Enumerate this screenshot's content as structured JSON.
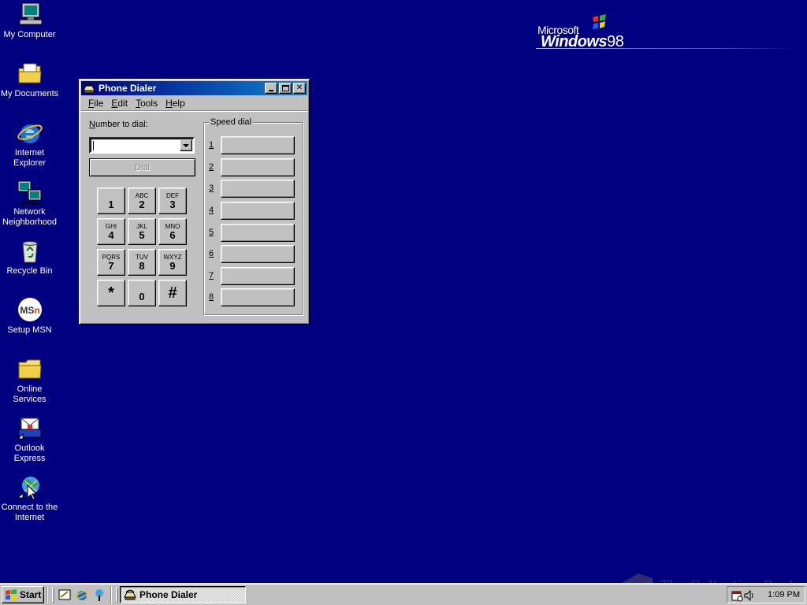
{
  "desktop": {
    "icons": [
      {
        "label": "My Computer"
      },
      {
        "label": "My Documents"
      },
      {
        "label": "Internet Explorer"
      },
      {
        "label": "Network Neighborhood"
      },
      {
        "label": "Recycle Bin"
      },
      {
        "label": "Setup MSN"
      },
      {
        "label": "Online Services"
      },
      {
        "label": "Outlook Express"
      },
      {
        "label": "Connect to the Internet"
      }
    ],
    "logo": {
      "brand": "Microsoft",
      "product": "Windows",
      "version": "98"
    }
  },
  "window": {
    "title": "Phone Dialer",
    "menu": [
      {
        "accel": "F",
        "rest": "ile"
      },
      {
        "accel": "E",
        "rest": "dit"
      },
      {
        "accel": "T",
        "rest": "ools"
      },
      {
        "accel": "H",
        "rest": "elp"
      }
    ],
    "number_label_accel": "N",
    "number_label_rest": "umber to dial:",
    "number_value": "",
    "dial_label": "Dial",
    "keypad": [
      {
        "letters": "",
        "digit": "1"
      },
      {
        "letters": "ABC",
        "digit": "2"
      },
      {
        "letters": "DEF",
        "digit": "3"
      },
      {
        "letters": "GHI",
        "digit": "4"
      },
      {
        "letters": "JKL",
        "digit": "5"
      },
      {
        "letters": "MNO",
        "digit": "6"
      },
      {
        "letters": "PQRS",
        "digit": "7"
      },
      {
        "letters": "TUV",
        "digit": "8"
      },
      {
        "letters": "WXYZ",
        "digit": "9"
      },
      {
        "letters": "",
        "digit": "*"
      },
      {
        "letters": "",
        "digit": "0"
      },
      {
        "letters": "",
        "digit": "#"
      }
    ],
    "speed_dial_label": "Speed dial",
    "speed_dial": [
      "1",
      "2",
      "3",
      "4",
      "5",
      "6",
      "7",
      "8"
    ]
  },
  "taskbar": {
    "start_label": "Start",
    "tasks": [
      {
        "label": "Phone Dialer"
      }
    ],
    "clock": "1:09 PM"
  },
  "watermark": "The Collection Book"
}
